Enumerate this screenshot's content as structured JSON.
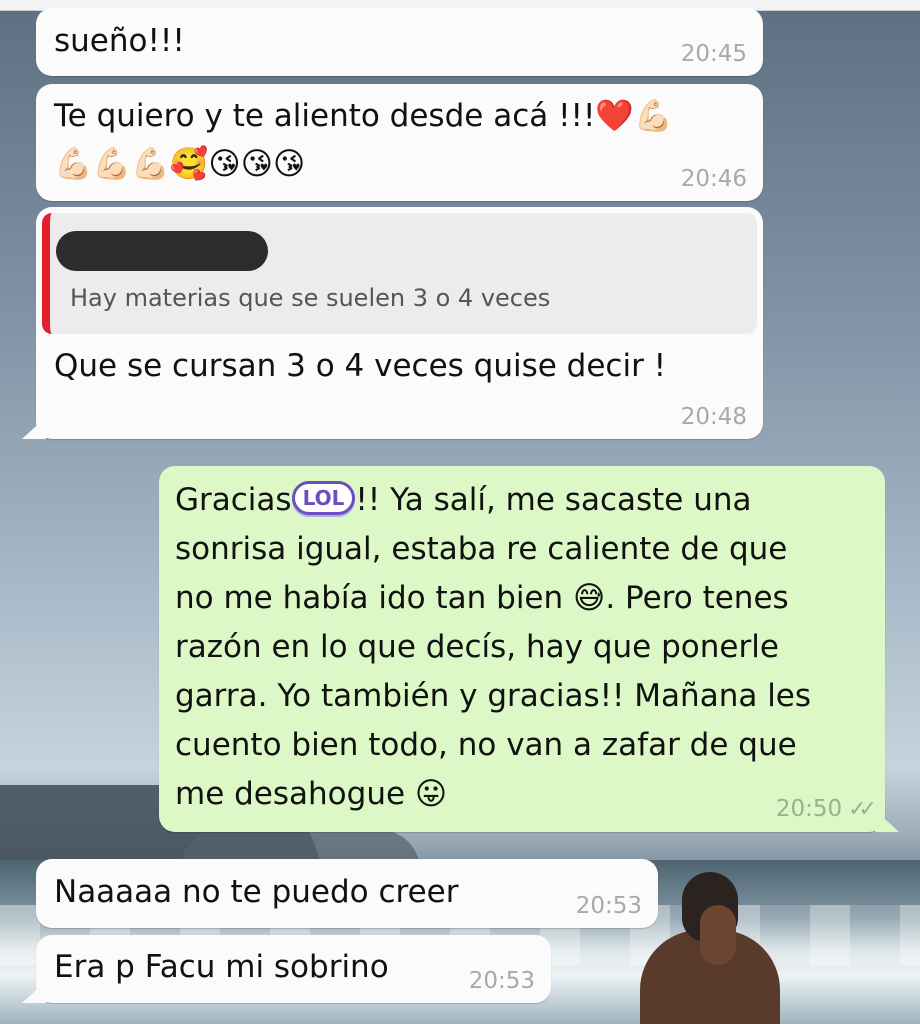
{
  "messages": [
    {
      "text": "sueño!!!",
      "time": "20:45"
    },
    {
      "text": "Te quiero y te aliento desde acá !!!❤️💪🏻",
      "text2": "💪🏻💪🏻💪🏻🥰😘😘😘",
      "time": "20:46"
    },
    {
      "quote": "Hay materias que se suelen 3 o 4 veces",
      "text": "Que se cursan 3 o 4 veces quise decir !",
      "time": "20:48"
    },
    {
      "lead": "Gracias",
      "sticker": "LOL",
      "lines": [
        "!! Ya salí, me sacaste una",
        "sonrisa igual, estaba re caliente de que",
        "no me había ido tan bien 😅. Pero tenes",
        "razón en lo que decís, hay que ponerle",
        "garra. Yo también y gracias!! Mañana les",
        "cuento bien todo, no van a zafar de que",
        "me desahogue 😛"
      ],
      "time": "20:50",
      "ticks": "✓✓"
    },
    {
      "text": "Naaaaa no te puedo creer",
      "time": "20:53"
    },
    {
      "text": "Era p Facu mi sobrino",
      "time": "20:53"
    }
  ]
}
